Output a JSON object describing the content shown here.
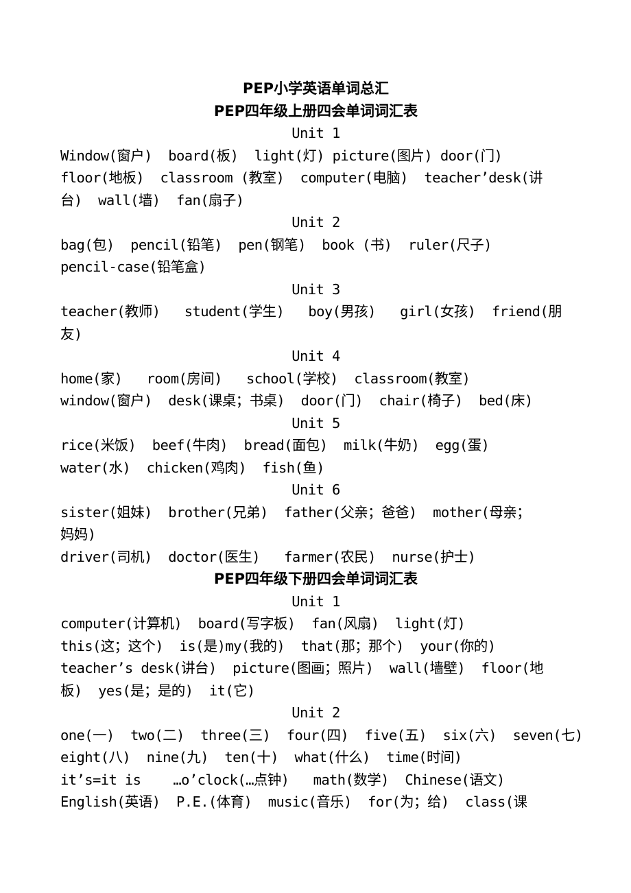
{
  "document": {
    "title": "PEP小学英语单词总汇",
    "sections": [
      {
        "heading": "PEP四年级上册四会单词词汇表",
        "units": [
          {
            "label": "Unit 1",
            "lines": [
              "Window(窗户)  board(板)  light(灯) picture(图片) door(门)",
              "floor(地板)  classroom (教室)  computer(电脑)  teacher’desk(讲",
              "台)  wall(墙)  fan(扇子)"
            ]
          },
          {
            "label": "Unit 2",
            "lines": [
              "bag(包)  pencil(铅笔)  pen(钢笔)  book (书)  ruler(尺子)",
              "pencil-case(铅笔盒)"
            ]
          },
          {
            "label": "Unit 3",
            "lines": [
              "teacher(教师)   student(学生)   boy(男孩)   girl(女孩)  friend(朋",
              "友)"
            ]
          },
          {
            "label": "Unit 4",
            "lines": [
              "home(家)   room(房间)   school(学校)  classroom(教室)",
              "window(窗户)  desk(课桌；书桌)  door(门)  chair(椅子)  bed(床)"
            ]
          },
          {
            "label": "Unit 5",
            "lines": [
              "rice(米饭)  beef(牛肉)  bread(面包)  milk(牛奶)  egg(蛋)",
              "water(水)  chicken(鸡肉)  fish(鱼)"
            ]
          },
          {
            "label": "Unit 6",
            "lines": [
              "sister(姐妹)  brother(兄弟)  father(父亲；爸爸)  mother(母亲；",
              "妈妈)",
              "driver(司机)  doctor(医生)   farmer(农民)  nurse(护士)"
            ]
          }
        ]
      },
      {
        "heading": "PEP四年级下册四会单词词汇表",
        "units": [
          {
            "label": "Unit 1",
            "lines": [
              "computer(计算机)  board(写字板)  fan(风扇)  light(灯)",
              "this(这；这个)  is(是)my(我的)  that(那；那个)  your(你的)",
              "teacher’s desk(讲台)  picture(图画；照片)  wall(墙壁)  floor(地",
              "板)  yes(是；是的)  it(它)"
            ]
          },
          {
            "label": "Unit 2",
            "lines": [
              "one(一)  two(二)  three(三)  four(四)  five(五)  six(六)  seven(七)",
              "eight(八)  nine(九)  ten(十)  what(什么)  time(时间)",
              "it’s=it is    …o’clock(…点钟)   math(数学)  Chinese(语文)",
              "English(英语)  P.E.(体育)  music(音乐)  for(为；给)  class(课"
            ]
          }
        ]
      }
    ]
  }
}
